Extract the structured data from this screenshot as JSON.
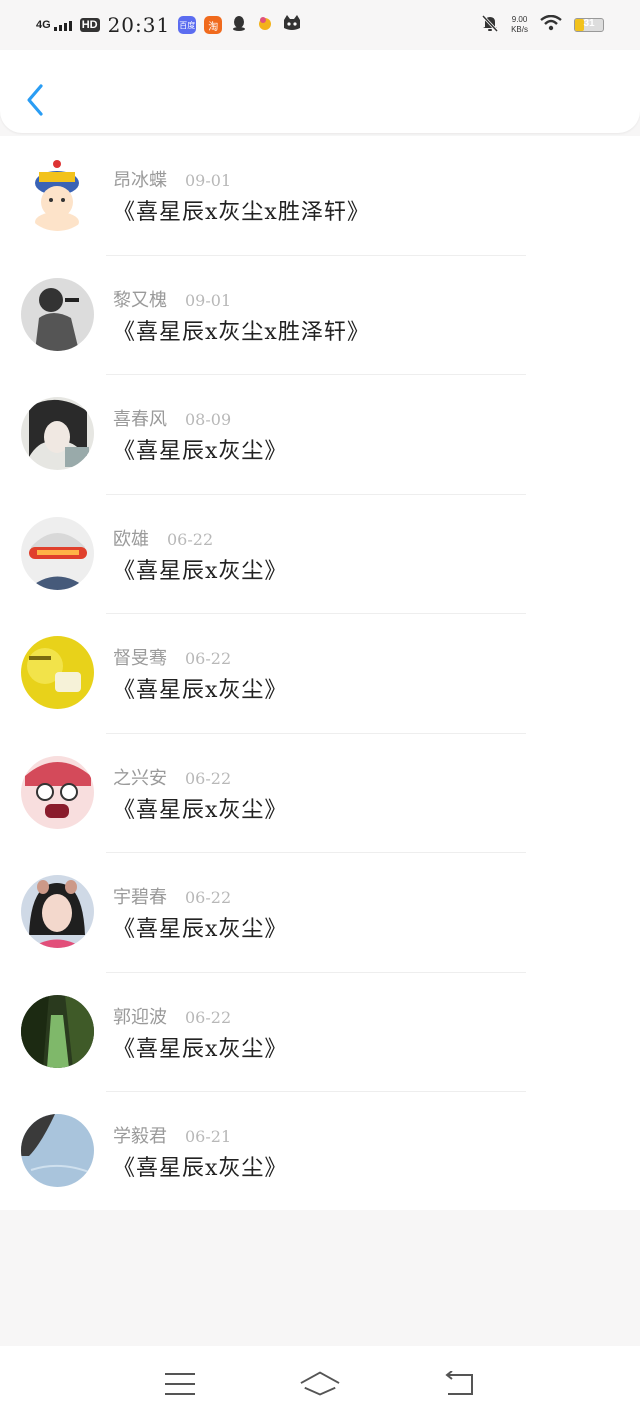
{
  "status_bar": {
    "network": "4G",
    "hd_label": "HD",
    "time": "20:31",
    "app_icons": [
      {
        "name": "baidu-app-icon",
        "label": "百度",
        "color": "#5b6cf0"
      },
      {
        "name": "taobao-app-icon",
        "label": "淘",
        "color": "#f06a1d"
      },
      {
        "name": "qq-icon",
        "label": "",
        "color": "#333333"
      },
      {
        "name": "game-app-icon",
        "label": "",
        "color": "#f3b21b"
      },
      {
        "name": "cat-app-icon",
        "label": "",
        "color": "#333333"
      }
    ],
    "speed_value": "9.00",
    "speed_unit": "KB/s",
    "battery": "31",
    "battery_level": 0.31
  },
  "header": {
    "back_icon": "chevron-left-icon",
    "accent_color": "#2a9df4"
  },
  "items": [
    {
      "name": "昂冰蝶",
      "date": "09-01",
      "title": "《喜星辰x灰尘x胜泽轩》"
    },
    {
      "name": "黎又槐",
      "date": "09-01",
      "title": "《喜星辰x灰尘x胜泽轩》"
    },
    {
      "name": "喜春风",
      "date": "08-09",
      "title": "《喜星辰x灰尘》"
    },
    {
      "name": "欧雄",
      "date": "06-22",
      "title": "《喜星辰x灰尘》"
    },
    {
      "name": "督旻骞",
      "date": "06-22",
      "title": "《喜星辰x灰尘》"
    },
    {
      "name": "之兴安",
      "date": "06-22",
      "title": "《喜星辰x灰尘》"
    },
    {
      "name": "宇碧春",
      "date": "06-22",
      "title": "《喜星辰x灰尘》"
    },
    {
      "name": "郭迎波",
      "date": "06-22",
      "title": "《喜星辰x灰尘》"
    },
    {
      "name": "学毅君",
      "date": "06-21",
      "title": "《喜星辰x灰尘》"
    }
  ],
  "navbar": {
    "menu_icon": "menu-icon",
    "home_icon": "home-icon",
    "back_icon": "return-icon"
  }
}
